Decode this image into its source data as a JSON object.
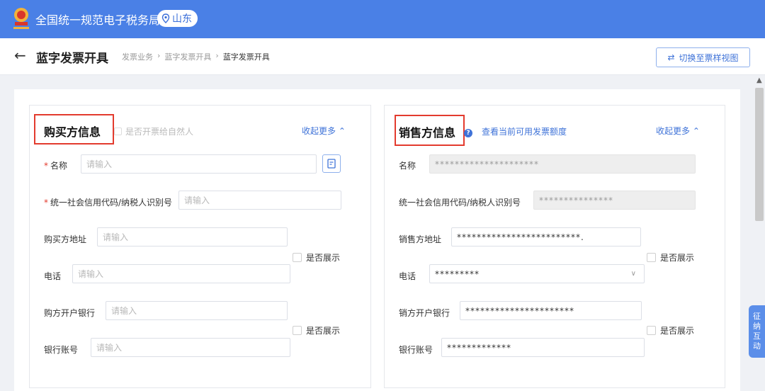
{
  "header": {
    "site_title": "全国统一规范电子税务局",
    "region": "山东",
    "brand_color": "#4a80e6"
  },
  "page": {
    "title": "蓝字发票开具",
    "breadcrumb": [
      "发票业务",
      "蓝字发票开具",
      "蓝字发票开具"
    ],
    "switch_button": "切换至票样视图"
  },
  "buyer": {
    "title": "购买方信息",
    "natural_person_label": "是否开票给自然人",
    "collapse_label": "收起更多",
    "name_label": "名称",
    "name_placeholder": "请输入",
    "tax_id_label": "统一社会信用代码/纳税人识别号",
    "tax_id_placeholder": "请输入",
    "address_label": "购买方地址",
    "address_placeholder": "请输入",
    "show_label_1": "是否展示",
    "phone_label": "电话",
    "phone_placeholder": "请输入",
    "bank_label": "购方开户银行",
    "bank_placeholder": "请输入",
    "show_label_2": "是否展示",
    "account_label": "银行账号",
    "account_placeholder": "请输入"
  },
  "seller": {
    "title": "销售方信息",
    "quota_link": "查看当前可用发票额度",
    "collapse_label": "收起更多",
    "name_label": "名称",
    "name_value": "*********************",
    "tax_id_label": "统一社会信用代码/纳税人识别号",
    "tax_id_value": "***************",
    "address_label": "销售方地址",
    "address_value": "*************************.",
    "show_label_1": "是否展示",
    "phone_label": "电话",
    "phone_value": "*********",
    "bank_label": "销方开户银行",
    "bank_value": "**********************",
    "show_label_2": "是否展示",
    "account_label": "银行账号",
    "account_value": "*************"
  },
  "side_tab": "征纳互动",
  "icons": [
    "tax-emblem-icon",
    "location-pin-icon",
    "back-arrow-icon",
    "switch-arrows-icon",
    "id-card-icon",
    "help-circle-icon",
    "chevron-up-icon",
    "chevron-down-icon"
  ]
}
